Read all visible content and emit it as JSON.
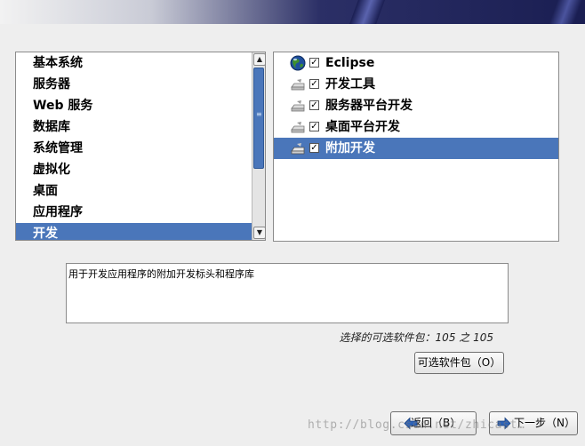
{
  "groups": {
    "items": [
      {
        "label": "基本系统"
      },
      {
        "label": "服务器"
      },
      {
        "label": "Web 服务"
      },
      {
        "label": "数据库"
      },
      {
        "label": "系统管理"
      },
      {
        "label": "虚拟化"
      },
      {
        "label": "桌面"
      },
      {
        "label": "应用程序"
      },
      {
        "label": "开发"
      }
    ],
    "selected_index": 8
  },
  "packages": {
    "items": [
      {
        "label": "Eclipse",
        "checked": true,
        "icon": "globe-icon"
      },
      {
        "label": "开发工具",
        "checked": true,
        "icon": "drive-icon"
      },
      {
        "label": "服务器平台开发",
        "checked": true,
        "icon": "drive-icon"
      },
      {
        "label": "桌面平台开发",
        "checked": true,
        "icon": "drive-icon"
      },
      {
        "label": "附加开发",
        "checked": true,
        "icon": "drive-icon"
      }
    ],
    "selected_index": 4
  },
  "description": "用于开发应用程序的附加开发标头和程序库",
  "count_text": "选择的可选软件包：105 之 105",
  "buttons": {
    "optional": "可选软件包（O）",
    "back": "返回（B）",
    "next": "下一步（N）"
  },
  "watermark": "http://blog.csdn.net/zhicast…",
  "colors": {
    "selection": "#4a76ba",
    "header_dark": "#1a1e52"
  }
}
